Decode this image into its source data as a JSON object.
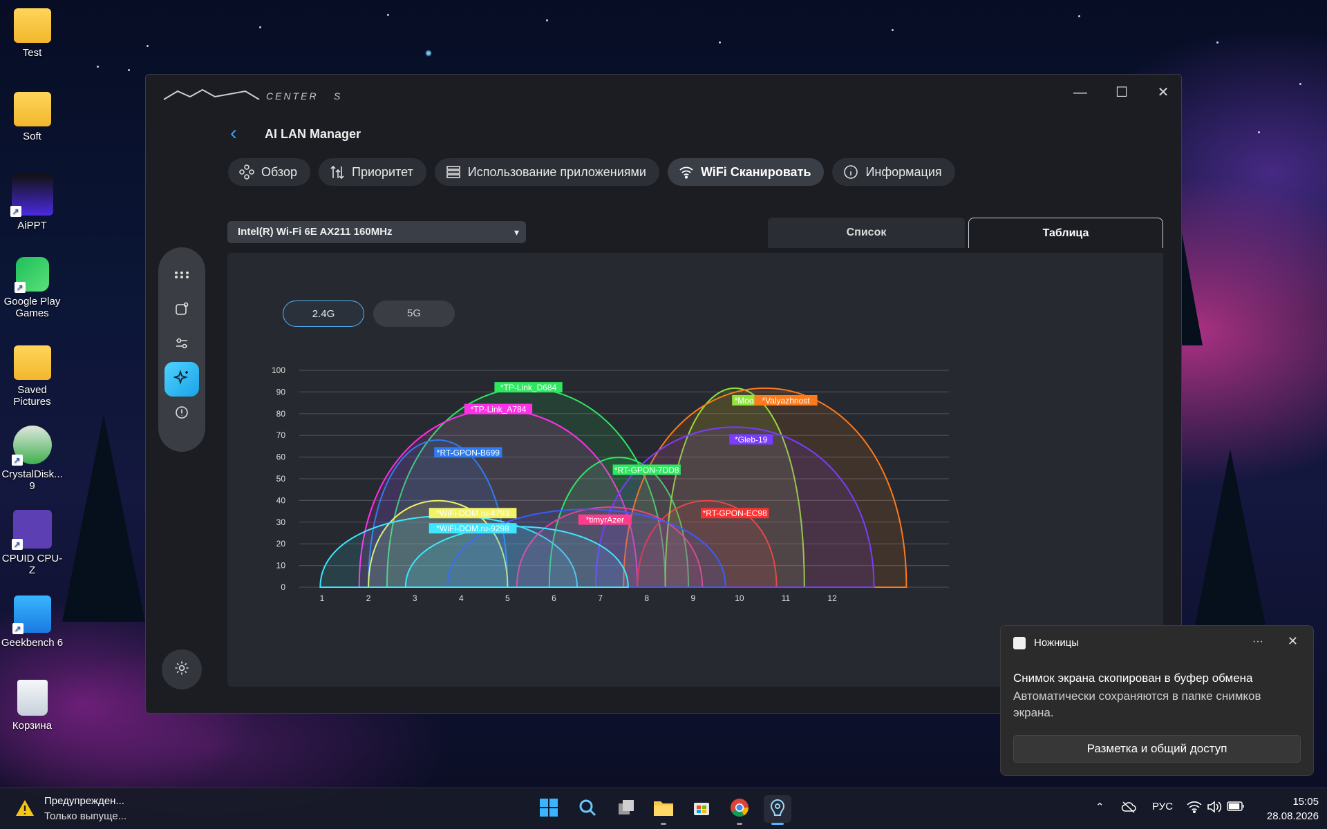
{
  "desktop": {
    "icons": [
      {
        "label": "Test",
        "icon": "folder-icon"
      },
      {
        "label": "Soft",
        "icon": "folder-icon"
      },
      {
        "label": "AiPPT",
        "icon": "aippt-icon"
      },
      {
        "label": "Google Play Games",
        "icon": "google-play-games-icon"
      },
      {
        "label": "Saved Pictures",
        "icon": "folder-icon"
      },
      {
        "label": "CrystalDisk... 9",
        "icon": "crystaldisk-icon"
      },
      {
        "label": "CPUID CPU-Z",
        "icon": "cpuz-icon"
      },
      {
        "label": "Geekbench 6",
        "icon": "geekbench-icon"
      },
      {
        "label": "Корзина",
        "icon": "recycle-bin-icon"
      }
    ]
  },
  "window": {
    "logo_icon": "msi-center-s-logo",
    "controls": [
      "minimize-icon",
      "maximize-icon",
      "close-icon"
    ],
    "app_title": "AI LAN Manager",
    "tabs": [
      {
        "label": "Обзор",
        "icon": "overview-icon"
      },
      {
        "label": "Приоритет",
        "icon": "priority-icon"
      },
      {
        "label": "Использование приложениями",
        "icon": "apps-usage-icon"
      },
      {
        "label": "WiFi Сканировать",
        "icon": "wifi-icon",
        "active": true
      },
      {
        "label": "Информация",
        "icon": "info-icon"
      }
    ],
    "adapter": "Intel(R) Wi-Fi 6E AX211 160MHz",
    "view_tabs": {
      "list": "Список",
      "table": "Таблица",
      "active": "Таблица"
    },
    "bands": {
      "b24": "2.4G",
      "b5": "5G",
      "active": "2.4G"
    },
    "rail_icons": [
      "apps-grid-icon",
      "device-icon",
      "sliders-icon",
      "ai-sparkle-icon",
      "alert-icon"
    ],
    "rail_active": "ai-sparkle-icon",
    "settings_icon": "gear-icon"
  },
  "chart_data": {
    "type": "area",
    "x_ticks": [
      1,
      2,
      3,
      4,
      5,
      6,
      7,
      8,
      9,
      10,
      11,
      12
    ],
    "y_ticks": [
      0,
      10,
      20,
      30,
      40,
      50,
      60,
      70,
      80,
      90,
      100
    ],
    "ylim": [
      0,
      100
    ],
    "grid": true,
    "series": [
      {
        "name": "*TP-Link_D684",
        "channel": 5.4,
        "x_from": 2.4,
        "x_to": 8.4,
        "signal": 92,
        "color": "#2ee860"
      },
      {
        "name": "*TP-Link_A784",
        "channel": 4.7,
        "x_from": 1.8,
        "x_to": 7.8,
        "signal": 82,
        "color": "#ff30e8"
      },
      {
        "name": "*RT-GPON-B699",
        "channel": 3.6,
        "x_from": 2.0,
        "x_to": 5.0,
        "signal": 68,
        "color": "#2f7bf0"
      },
      {
        "name": "*RT-GPON-7DD8",
        "channel": 7.4,
        "x_from": 5.9,
        "x_to": 8.9,
        "signal": 60,
        "color": "#2ee860"
      },
      {
        "name": "*WiFi-DOM.ru-4793",
        "channel": 3.5,
        "x_from": 2.0,
        "x_to": 5.0,
        "signal": 40,
        "color": "#f2f266"
      },
      {
        "name": "*WiFi-DOM.ru-9298",
        "channel": 3.5,
        "x_from": 0.96,
        "x_to": 6.5,
        "signal": 33,
        "color": "#3ee6ff"
      },
      {
        "name": "*timyrAzer",
        "channel": 7.2,
        "x_from": 5.2,
        "x_to": 9.2,
        "signal": 37,
        "color": "#ff3c8c"
      },
      {
        "name": "*RT-GPON-EC98",
        "channel": 9.3,
        "x_from": 7.8,
        "x_to": 10.8,
        "signal": 40,
        "color": "#ff3030"
      },
      {
        "name": "*Moon",
        "channel": 9.9,
        "x_from": 8.4,
        "x_to": 11.4,
        "signal": 92,
        "color": "#8ee83c"
      },
      {
        "name": "*Valyazhnost",
        "channel": 10.6,
        "x_from": 7.5,
        "x_to": 13.6,
        "signal": 92,
        "color": "#ff7a1a"
      },
      {
        "name": "*Gleb-19",
        "channel": 10.0,
        "x_from": 6.9,
        "x_to": 12.9,
        "signal": 74,
        "color": "#7a3cff"
      },
      {
        "name": "",
        "channel": 6.2,
        "x_from": 3.7,
        "x_to": 9.7,
        "signal": 36,
        "color": "#3a5cff"
      },
      {
        "name": "",
        "channel": 5.0,
        "x_from": 2.8,
        "x_to": 7.6,
        "signal": 28,
        "color": "#3ee6ff"
      }
    ]
  },
  "notification": {
    "app": "Ножницы",
    "title": "Снимок экрана скопирован в буфер обмена",
    "body": "Автоматически сохраняются в папке снимков экрана.",
    "action": "Разметка и общий доступ",
    "more": "···",
    "close": "✕"
  },
  "taskbar": {
    "warning_title": "Предупрежден...",
    "warning_sub": "Только выпуще...",
    "apps": [
      "windows-start-icon",
      "search-icon",
      "task-view-icon",
      "file-explorer-icon",
      "store-icon",
      "chrome-icon",
      "msi-center-icon"
    ],
    "language": "РУС",
    "time": "15:05",
    "date": "28.08.2026"
  }
}
